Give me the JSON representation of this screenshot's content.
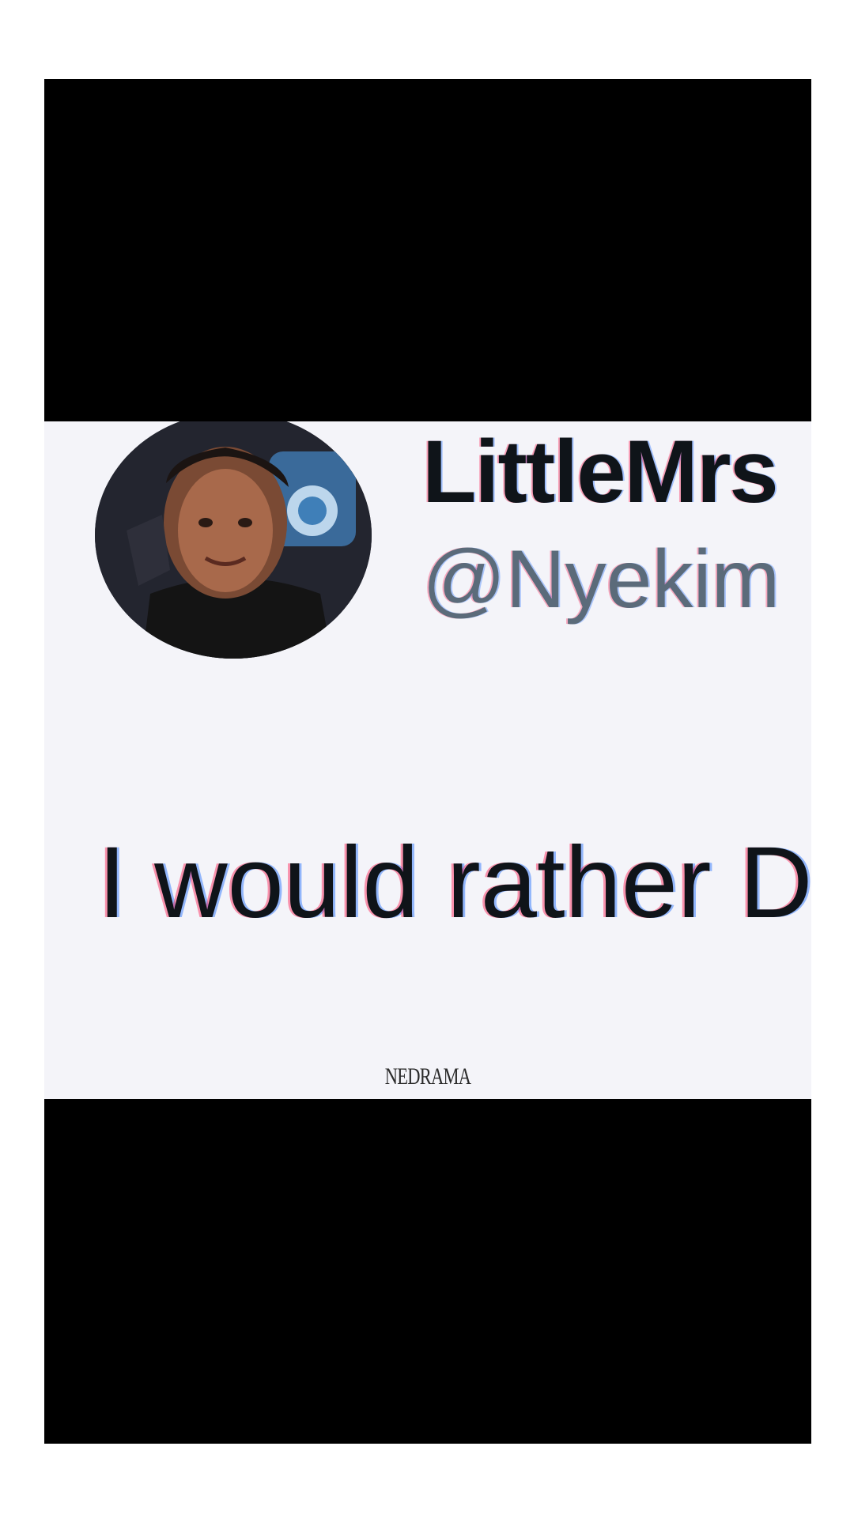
{
  "tweet": {
    "display_name": "LittleMrs",
    "handle": "@Nyekim",
    "text": "I would rather D",
    "avatar_icon": "profile-photo"
  },
  "watermark": {
    "text": "NEDRAMA"
  },
  "colors": {
    "letterbox": "#000000",
    "tweet_background": "#f4f4f9",
    "name_color": "#0f1419",
    "handle_color": "#5b6b7a"
  }
}
